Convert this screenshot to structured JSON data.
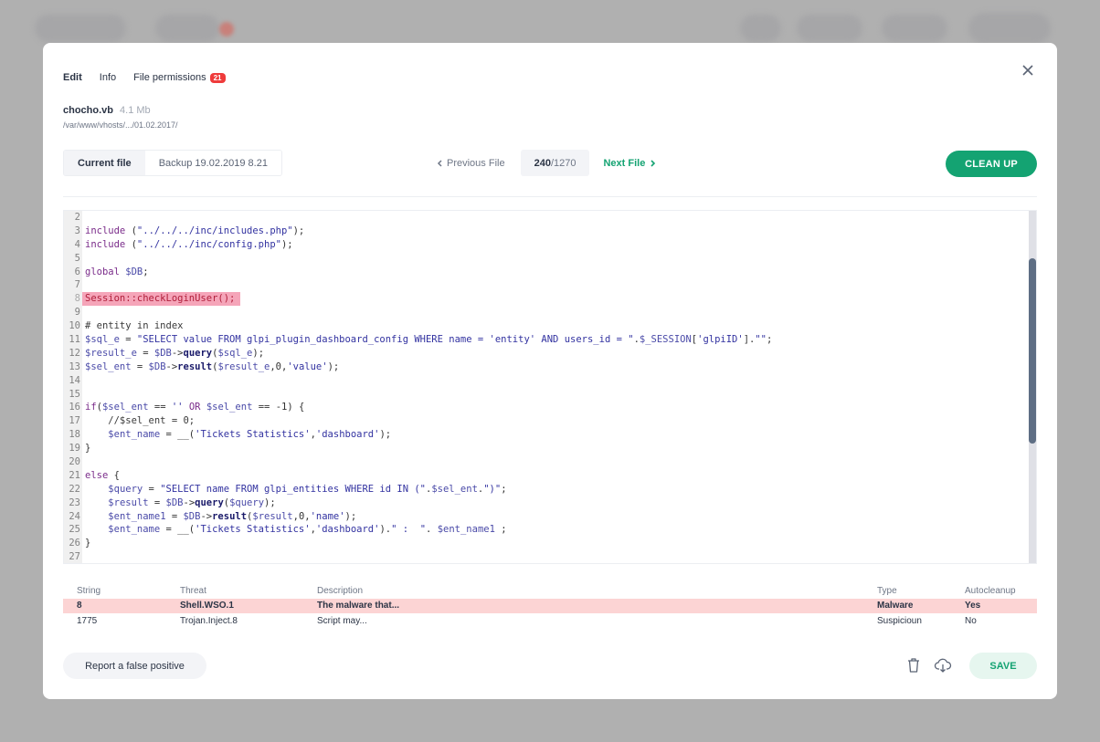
{
  "tabs": [
    {
      "label": "Edit",
      "active": true
    },
    {
      "label": "Info",
      "active": false
    },
    {
      "label": "File permissions",
      "active": false,
      "badge": "21"
    }
  ],
  "file": {
    "name": "chocho.vb",
    "size": "4.1 Mb",
    "path": "/var/www/vhosts/.../01.02.2017/"
  },
  "version_switch": {
    "current": "Current file",
    "backup": "Backup 19.02.2019 8.21"
  },
  "navigation": {
    "previous": "Previous File",
    "current_index": "240",
    "total": "/1270",
    "next": "Next File"
  },
  "actions": {
    "cleanup": "CLEAN UP",
    "report": "Report a false positive",
    "save": "SAVE"
  },
  "colors": {
    "accent": "#14a372",
    "danger_row": "#fcd4d4",
    "highlight_line": "#f5a5b9",
    "badge": "#ef3b3b"
  },
  "editor": {
    "highlighted_line": 8,
    "lines": [
      {
        "n": "2",
        "code": ""
      },
      {
        "n": "3",
        "code": "include (\"../../../inc/includes.php\");"
      },
      {
        "n": "4",
        "code": "include (\"../../../inc/config.php\");"
      },
      {
        "n": "5",
        "code": ""
      },
      {
        "n": "6",
        "code": "global $DB;"
      },
      {
        "n": "7",
        "code": ""
      },
      {
        "n": "8",
        "code": "Session::checkLoginUser();"
      },
      {
        "n": "9",
        "code": ""
      },
      {
        "n": "10",
        "code": "# entity in index"
      },
      {
        "n": "11",
        "code": "$sql_e = \"SELECT value FROM glpi_plugin_dashboard_config WHERE name = 'entity' AND users_id = \".$_SESSION['glpiID'].\"\";"
      },
      {
        "n": "12",
        "code": "$result_e = $DB->query($sql_e);"
      },
      {
        "n": "13",
        "code": "$sel_ent = $DB->result($result_e,0,'value');"
      },
      {
        "n": "14",
        "code": ""
      },
      {
        "n": "15",
        "code": ""
      },
      {
        "n": "16",
        "code": "if($sel_ent == '' OR $sel_ent == -1) {"
      },
      {
        "n": "17",
        "code": "    //$sel_ent = 0;"
      },
      {
        "n": "18",
        "code": "    $ent_name = __('Tickets Statistics','dashboard');"
      },
      {
        "n": "19",
        "code": "}"
      },
      {
        "n": "20",
        "code": ""
      },
      {
        "n": "21",
        "code": "else {"
      },
      {
        "n": "22",
        "code": "    $query = \"SELECT name FROM glpi_entities WHERE id IN (\".$sel_ent.\")\";"
      },
      {
        "n": "23",
        "code": "    $result = $DB->query($query);"
      },
      {
        "n": "24",
        "code": "    $ent_name1 = $DB->result($result,0,'name');"
      },
      {
        "n": "25",
        "code": "    $ent_name = __('Tickets Statistics','dashboard').\" :  \". $ent_name1 ;"
      },
      {
        "n": "26",
        "code": "}"
      },
      {
        "n": "27",
        "code": ""
      }
    ]
  },
  "threats": {
    "headers": [
      "String",
      "Threat",
      "Description",
      "Type",
      "Autocleanup"
    ],
    "rows": [
      {
        "string": "8",
        "threat": "Shell.WSO.1",
        "description": "The malware that...",
        "type": "Malware",
        "autocleanup": "Yes",
        "severity": "danger"
      },
      {
        "string": "1775",
        "threat": "Trojan.Inject.8",
        "description": "Script may...",
        "type": "Suspicioun",
        "autocleanup": "No",
        "severity": "normal"
      }
    ]
  },
  "icons": {
    "close": "close-icon",
    "prev": "chevron-left-icon",
    "next": "chevron-right-icon",
    "trash": "trash-icon",
    "download": "cloud-download-icon"
  }
}
